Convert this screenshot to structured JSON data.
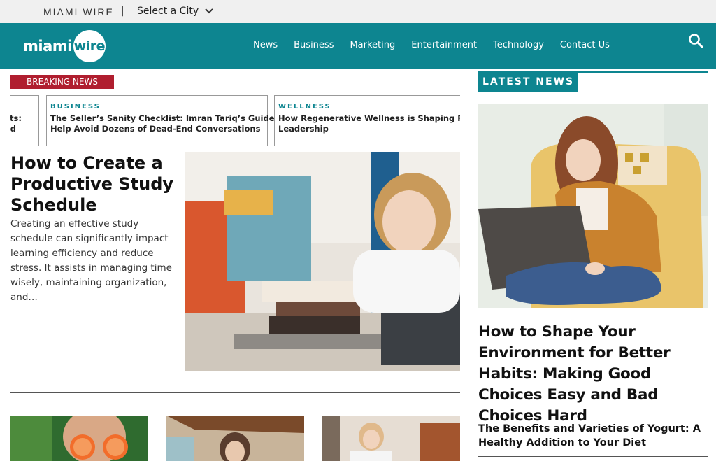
{
  "topbar": {
    "brand": "MIAMI WIRE",
    "separator": "|",
    "city_select_label": "Select a City"
  },
  "logo": {
    "part1": "miami",
    "part2": "wire"
  },
  "nav": {
    "items": [
      "News",
      "Business",
      "Marketing",
      "Entertainment",
      "Technology",
      "Contact Us"
    ],
    "search_icon": "search-icon"
  },
  "breaking": {
    "label": "BREAKING NEWS"
  },
  "ticker": [
    {
      "category": "",
      "title_line1": "ts:",
      "title_line2": "d"
    },
    {
      "category": "BUSINESS",
      "title_line1": "The Seller’s Sanity Checklist: Imran Tariq’s Guide to",
      "title_line2": "Help Avoid Dozens of Dead-End Conversations"
    },
    {
      "category": "WELLNESS",
      "title_line1": "How Regenerative Wellness is Shaping Founde",
      "title_line2": "Leadership"
    }
  ],
  "feature": {
    "title": "How to Create a Productive Study Schedule",
    "excerpt": "Creating an effective study schedule can significantly impact learning efficiency and reduce stress. It assists in managing time wisely, maintaining organization, and…"
  },
  "latest": {
    "label": "LATEST NEWS",
    "lead_title": "How to Shape Your Environment for Better Habits: Making Good Choices Easy and Bad Choices Hard",
    "second_title": "The Benefits and Varieties of Yogurt: A Healthy Addition to Your Diet"
  },
  "colors": {
    "teal": "#0d8590",
    "breaking_red": "#b01e2f",
    "topbar_bg": "#f0f0f0"
  }
}
